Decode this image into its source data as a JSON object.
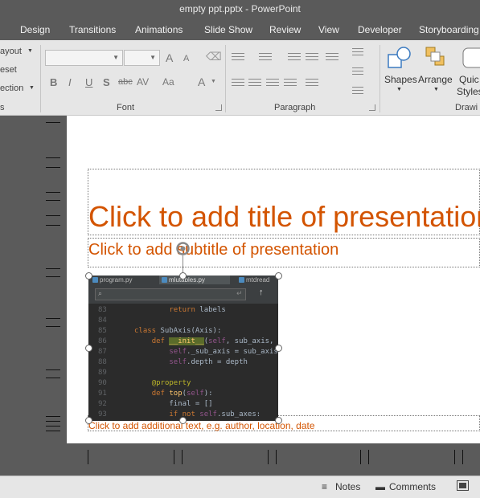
{
  "window": {
    "title": "empty ppt.pptx - PowerPoint"
  },
  "tabs": [
    {
      "label": "Design"
    },
    {
      "label": "Transitions"
    },
    {
      "label": "Animations"
    },
    {
      "label": "Slide Show"
    },
    {
      "label": "Review"
    },
    {
      "label": "View"
    },
    {
      "label": "Developer"
    },
    {
      "label": "Storyboarding"
    }
  ],
  "ribbon": {
    "slides_group": {
      "layout_label": "ayout",
      "reset_label": "eset",
      "section_label": "ection",
      "group_label": "s"
    },
    "font_group": {
      "font_name_value": "",
      "font_size_value": "",
      "group_label": "Font",
      "bold": "B",
      "italic": "I",
      "underline": "U",
      "shadow": "S",
      "strike": "abc",
      "spacing": "AV",
      "case": "Aa",
      "color": "A",
      "grow": "A",
      "shrink": "A"
    },
    "paragraph_group": {
      "group_label": "Paragraph"
    },
    "drawing_group": {
      "shapes_label": "Shapes",
      "arrange_label": "Arrange",
      "quick_styles_label_1": "Quic",
      "quick_styles_label_2": "Styles",
      "group_label": "Drawi"
    }
  },
  "slide": {
    "title_placeholder": "Click to add title of presentation",
    "subtitle_placeholder": "Click to add subtitle of presentation",
    "additional_placeholder": "Click to add additional text, e.g. author, location, date"
  },
  "screenshot": {
    "tabs": [
      {
        "label": "program.py"
      },
      {
        "label": "mlutables.py"
      },
      {
        "label": "mtdread"
      }
    ],
    "lines": [
      {
        "num": "83",
        "code": "    return labels"
      },
      {
        "num": "84",
        "code": ""
      },
      {
        "num": "85",
        "code": "class SubAxis(Axis):"
      },
      {
        "num": "86",
        "code": "    def __init__(self, sub_axis, depth):"
      },
      {
        "num": "87",
        "code": "        self._sub_axis = sub_axis"
      },
      {
        "num": "88",
        "code": "        self.depth = depth"
      },
      {
        "num": "89",
        "code": ""
      },
      {
        "num": "90",
        "code": "    @property"
      },
      {
        "num": "91",
        "code": "    def top(self):"
      },
      {
        "num": "92",
        "code": "        final = []"
      },
      {
        "num": "93",
        "code": "        if not self.sub_axes:"
      }
    ]
  },
  "statusbar": {
    "notes_label": "Notes",
    "comments_label": "Comments"
  },
  "colors": {
    "placeholder_text": "#d35400",
    "ribbon_bg": "#e6e6e6",
    "chrome_bg": "#5a5a5a"
  }
}
